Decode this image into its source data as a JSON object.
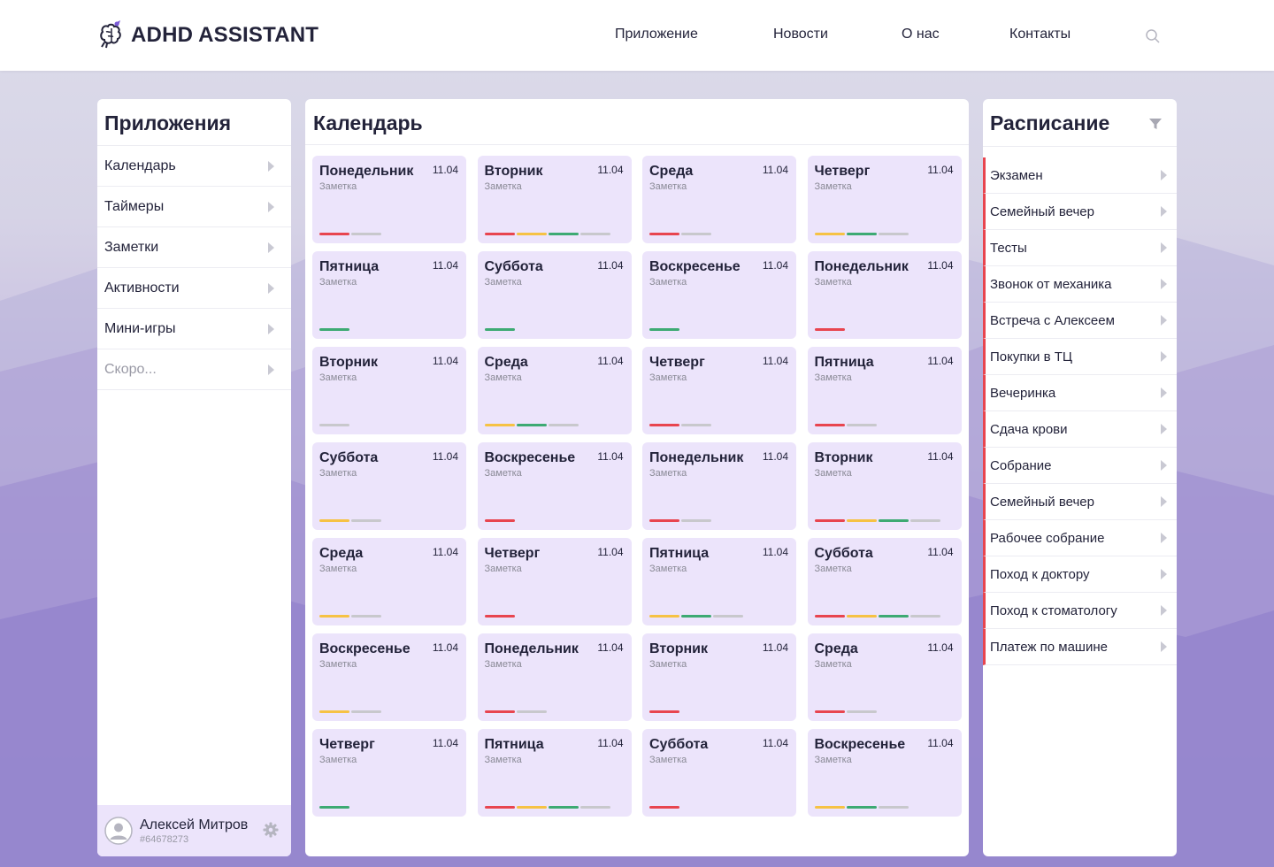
{
  "brand": {
    "name": "ADHD ASSISTANT",
    "icon": "brain-rocket-icon"
  },
  "nav": [
    "Приложение",
    "Новости",
    "О нас",
    "Контакты"
  ],
  "colors": {
    "accent": "#e8454f",
    "card": "#ece4fb",
    "bar_red": "#e8454f",
    "bar_yellow": "#f6c244",
    "bar_green": "#3daa73",
    "bar_gray": "#c8c8cc"
  },
  "apps": {
    "title": "Приложения",
    "items": [
      "Календарь",
      "Таймеры",
      "Заметки",
      "Активности",
      "Мини-игры",
      "Скоро..."
    ]
  },
  "user": {
    "name": "Алексей Митров",
    "id": "#64678273"
  },
  "calendar": {
    "title": "Календарь",
    "days": [
      {
        "name": "Понедельник",
        "date": "11.04",
        "note": "Заметка",
        "bars": [
          "red",
          "gray"
        ]
      },
      {
        "name": "Вторник",
        "date": "11.04",
        "note": "Заметка",
        "bars": [
          "red",
          "yellow",
          "green",
          "gray"
        ]
      },
      {
        "name": "Среда",
        "date": "11.04",
        "note": "Заметка",
        "bars": [
          "red",
          "gray"
        ]
      },
      {
        "name": "Четверг",
        "date": "11.04",
        "note": "Заметка",
        "bars": [
          "yellow",
          "green",
          "gray"
        ]
      },
      {
        "name": "Пятница",
        "date": "11.04",
        "note": "Заметка",
        "bars": [
          "green"
        ]
      },
      {
        "name": "Суббота",
        "date": "11.04",
        "note": "Заметка",
        "bars": [
          "green"
        ]
      },
      {
        "name": "Воскресенье",
        "date": "11.04",
        "note": "Заметка",
        "bars": [
          "green"
        ]
      },
      {
        "name": "Понедельник",
        "date": "11.04",
        "note": "Заметка",
        "bars": [
          "red"
        ]
      },
      {
        "name": "Вторник",
        "date": "11.04",
        "note": "Заметка",
        "bars": [
          "gray"
        ]
      },
      {
        "name": "Среда",
        "date": "11.04",
        "note": "Заметка",
        "bars": [
          "yellow",
          "green",
          "gray"
        ]
      },
      {
        "name": "Четверг",
        "date": "11.04",
        "note": "Заметка",
        "bars": [
          "red",
          "gray"
        ]
      },
      {
        "name": "Пятница",
        "date": "11.04",
        "note": "Заметка",
        "bars": [
          "red",
          "gray"
        ]
      },
      {
        "name": "Суббота",
        "date": "11.04",
        "note": "Заметка",
        "bars": [
          "yellow",
          "gray"
        ]
      },
      {
        "name": "Воскресенье",
        "date": "11.04",
        "note": "Заметка",
        "bars": [
          "red"
        ]
      },
      {
        "name": "Понедельник",
        "date": "11.04",
        "note": "Заметка",
        "bars": [
          "red",
          "gray"
        ]
      },
      {
        "name": "Вторник",
        "date": "11.04",
        "note": "Заметка",
        "bars": [
          "red",
          "yellow",
          "green",
          "gray"
        ]
      },
      {
        "name": "Среда",
        "date": "11.04",
        "note": "Заметка",
        "bars": [
          "yellow",
          "gray"
        ]
      },
      {
        "name": "Четверг",
        "date": "11.04",
        "note": "Заметка",
        "bars": [
          "red"
        ]
      },
      {
        "name": "Пятница",
        "date": "11.04",
        "note": "Заметка",
        "bars": [
          "yellow",
          "green",
          "gray"
        ]
      },
      {
        "name": "Суббота",
        "date": "11.04",
        "note": "Заметка",
        "bars": [
          "red",
          "yellow",
          "green",
          "gray"
        ]
      },
      {
        "name": "Воскресенье",
        "date": "11.04",
        "note": "Заметка",
        "bars": [
          "yellow",
          "gray"
        ]
      },
      {
        "name": "Понедельник",
        "date": "11.04",
        "note": "Заметка",
        "bars": [
          "red",
          "gray"
        ]
      },
      {
        "name": "Вторник",
        "date": "11.04",
        "note": "Заметка",
        "bars": [
          "red"
        ]
      },
      {
        "name": "Среда",
        "date": "11.04",
        "note": "Заметка",
        "bars": [
          "red",
          "gray"
        ]
      },
      {
        "name": "Четверг",
        "date": "11.04",
        "note": "Заметка",
        "bars": [
          "green"
        ]
      },
      {
        "name": "Пятница",
        "date": "11.04",
        "note": "Заметка",
        "bars": [
          "red",
          "yellow",
          "green",
          "gray"
        ]
      },
      {
        "name": "Суббота",
        "date": "11.04",
        "note": "Заметка",
        "bars": [
          "red"
        ]
      },
      {
        "name": "Воскресенье",
        "date": "11.04",
        "note": "Заметка",
        "bars": [
          "yellow",
          "green",
          "gray"
        ]
      }
    ]
  },
  "schedule": {
    "title": "Расписание",
    "filter_icon": "filter-icon",
    "items": [
      "Экзамен",
      "Семейный вечер",
      "Тесты",
      "Звонок от механика",
      "Встреча с Алексеем",
      "Покупки в ТЦ",
      "Вечеринка",
      "Сдача крови",
      "Собрание",
      "Семейный вечер",
      "Рабочее собрание",
      "Поход к доктору",
      "Поход к стоматологу",
      "Платеж по машине"
    ]
  }
}
